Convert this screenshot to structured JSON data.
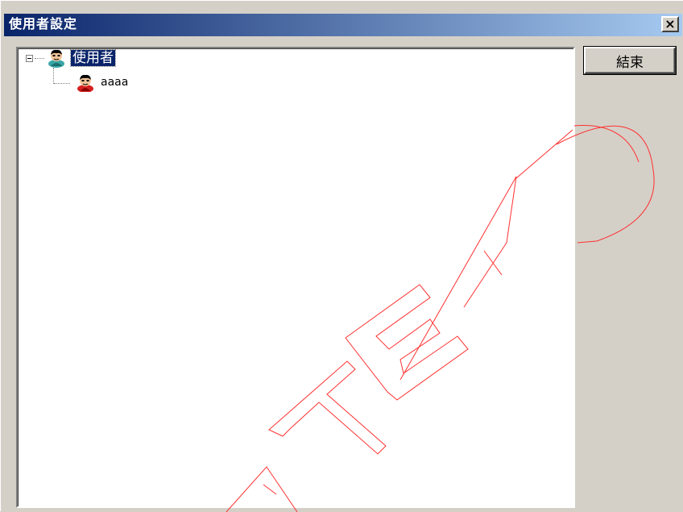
{
  "window": {
    "title": "使用者設定",
    "close_glyph": "×"
  },
  "tree": {
    "root": {
      "label": "使用者",
      "icon": "user-group-icon",
      "expanded": true,
      "selected": true
    },
    "children": [
      {
        "label": "aaaa",
        "icon": "user-icon"
      }
    ]
  },
  "buttons": {
    "end_label": "結束"
  },
  "colors": {
    "title_start": "#0a246a",
    "title_end": "#a6caf0",
    "face": "#d4d0c8",
    "selection": "#0a246a",
    "watermark": "#ff3030"
  }
}
